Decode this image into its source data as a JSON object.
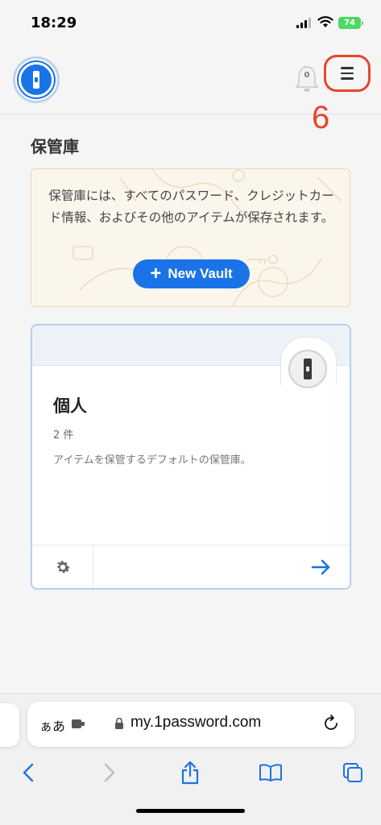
{
  "status_bar": {
    "time": "18:29",
    "battery": "74"
  },
  "header": {
    "notifications_count": "0"
  },
  "annotation": "6",
  "page": {
    "title": "保管庫",
    "promo": {
      "text": "保管庫には、すべてのパスワード、クレジットカード情報、およびその他のアイテムが保存されます。",
      "button_label": "New Vault"
    },
    "vault": {
      "name": "個人",
      "count": "2 件",
      "description": "アイテムを保管するデフォルトの保管庫。"
    }
  },
  "browser": {
    "text_size_label": "ぁあ",
    "url": "my.1password.com"
  },
  "colors": {
    "accent": "#1a73e8",
    "annotation": "#e8452c",
    "battery": "#4cd964"
  }
}
